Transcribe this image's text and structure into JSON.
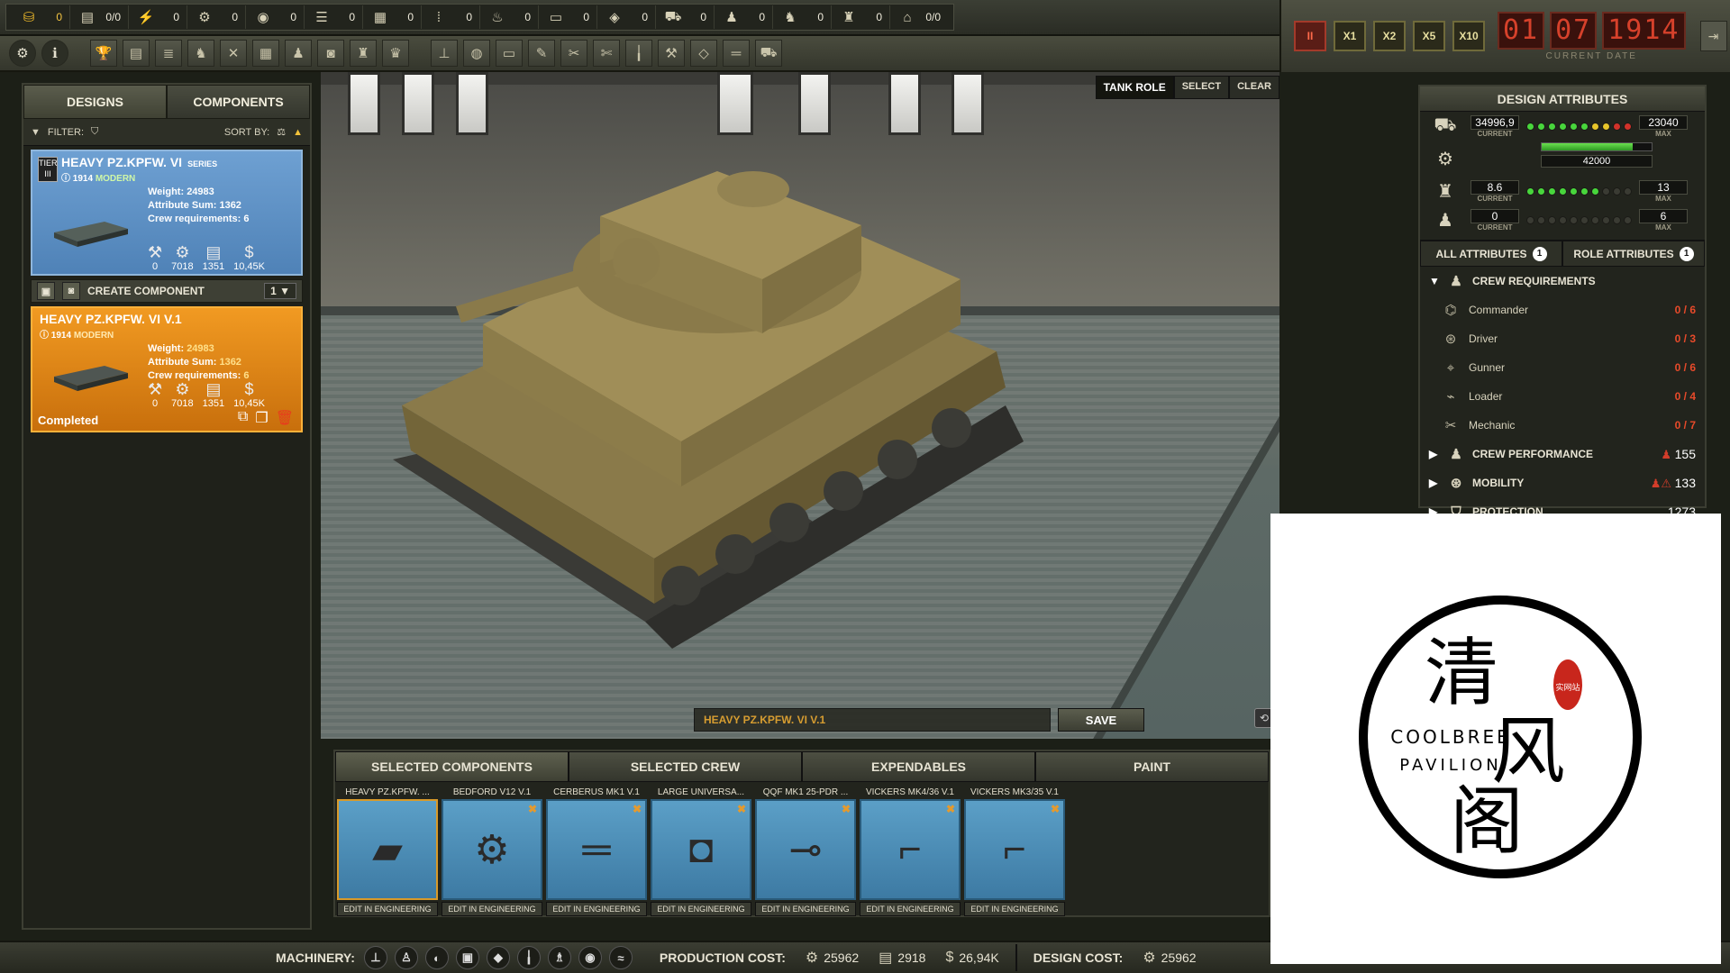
{
  "resources": [
    {
      "icon": "gold-icon",
      "value": "0",
      "gold": true
    },
    {
      "icon": "steel-icon",
      "value": "0/0"
    },
    {
      "icon": "bolt-icon",
      "value": "0"
    },
    {
      "icon": "gear-parts-icon",
      "value": "0"
    },
    {
      "icon": "coal-icon",
      "value": "0"
    },
    {
      "icon": "timber-icon",
      "value": "0"
    },
    {
      "icon": "crate-icon",
      "value": "0"
    },
    {
      "icon": "ammo-icon",
      "value": "0"
    },
    {
      "icon": "fuel-icon",
      "value": "0"
    },
    {
      "icon": "plate-icon",
      "value": "0"
    },
    {
      "icon": "stack-icon",
      "value": "0"
    },
    {
      "icon": "truck-icon",
      "value": "0"
    },
    {
      "icon": "worker-icon",
      "value": "0"
    },
    {
      "icon": "engineer-icon",
      "value": "0"
    },
    {
      "icon": "officer-icon",
      "value": "0"
    },
    {
      "icon": "house-icon",
      "value": "0/0"
    }
  ],
  "speed_controls": [
    "II",
    "X1",
    "X2",
    "X5",
    "X10"
  ],
  "date": {
    "day": "01",
    "month": "07",
    "year": "1914",
    "label": "CURRENT DATE"
  },
  "left_tabs": {
    "designs": "DESIGNS",
    "components": "COMPONENTS"
  },
  "filter": {
    "filter_label": "FILTER:",
    "sort_label": "SORT BY:"
  },
  "card1": {
    "tier": "TIER III",
    "title": "HEAVY PZ.KPFW. VI",
    "series": "SERIES",
    "year": "1914",
    "era": "MODERN",
    "weight_label": "Weight:",
    "weight": "24983",
    "attr_label": "Attribute Sum:",
    "attr": "1362",
    "crew_label": "Crew requirements:",
    "crew": "6",
    "icons": [
      "0",
      "7018",
      "1351",
      "10,45K"
    ]
  },
  "create_component": {
    "label": "CREATE COMPONENT",
    "count": "1"
  },
  "card2": {
    "title": "HEAVY PZ.KPFW. VI V.1",
    "year": "1914",
    "era": "MODERN",
    "weight_label": "Weight:",
    "weight": "24983",
    "attr_label": "Attribute Sum:",
    "attr": "1362",
    "crew_label": "Crew requirements:",
    "crew": "6",
    "icons": [
      "0",
      "7018",
      "1351",
      "10,45K"
    ],
    "status": "Completed"
  },
  "viewport": {
    "tank_role": "TANK ROLE",
    "select": "SELECT",
    "clear": "CLEAR",
    "design_name": "HEAVY PZ.KPFW. VI V.1",
    "save": "SAVE"
  },
  "design_attributes": {
    "title": "DESIGN ATTRIBUTES",
    "rows": [
      {
        "current": "34996,9",
        "max": "23040",
        "leds": "ggggggyyrr"
      },
      {
        "current": "8.6",
        "max": "13",
        "leds": "gggggggooo"
      },
      {
        "current": "0",
        "max": "6",
        "leds": "oooooooooo"
      }
    ],
    "current_label": "CURRENT",
    "max_label": "MAX",
    "progress_value": "42000",
    "progress_fraction": 0.83,
    "tabs": {
      "all": "ALL ATTRIBUTES",
      "all_badge": "1",
      "role": "ROLE ATTRIBUTES",
      "role_badge": "1"
    },
    "crew_section": "CREW REQUIREMENTS",
    "crew": [
      {
        "name": "Commander",
        "val": "0 / 6"
      },
      {
        "name": "Driver",
        "val": "0 / 3"
      },
      {
        "name": "Gunner",
        "val": "0 / 6"
      },
      {
        "name": "Loader",
        "val": "0 / 4"
      },
      {
        "name": "Mechanic",
        "val": "0 / 7"
      }
    ],
    "sections": [
      {
        "name": "CREW PERFORMANCE",
        "val": "155"
      },
      {
        "name": "MOBILITY",
        "val": "133"
      },
      {
        "name": "PROTECTION",
        "val": "1273"
      }
    ]
  },
  "bottom_tabs": [
    "SELECTED COMPONENTS",
    "SELECTED CREW",
    "EXPENDABLES",
    "PAINT"
  ],
  "components": [
    {
      "name": "HEAVY PZ.KPFW. ...",
      "edit": "EDIT IN ENGINEERING"
    },
    {
      "name": "BEDFORD V12 V.1",
      "edit": "EDIT IN ENGINEERING"
    },
    {
      "name": "CERBERUS MK1 V.1",
      "edit": "EDIT IN ENGINEERING"
    },
    {
      "name": "LARGE UNIVERSA...",
      "edit": "EDIT IN ENGINEERING"
    },
    {
      "name": "QQF MK1 25-PDR ...",
      "edit": "EDIT IN ENGINEERING"
    },
    {
      "name": "VICKERS MK4/36 V.1",
      "edit": "EDIT IN ENGINEERING"
    },
    {
      "name": "VICKERS MK3/35 V.1",
      "edit": "EDIT IN ENGINEERING"
    }
  ],
  "statusbar": {
    "machinery": "MACHINERY:",
    "production_cost": "PRODUCTION COST:",
    "prod_gears": "25962",
    "prod_steel": "2918",
    "prod_money": "26,94K",
    "design_cost": "DESIGN COST:",
    "design_gears": "25962"
  },
  "watermark": {
    "line1": "COOLBREE",
    "line2": "PAVILION",
    "c1": "清",
    "c2": "风",
    "c3": "阁",
    "seal": "实网站"
  }
}
